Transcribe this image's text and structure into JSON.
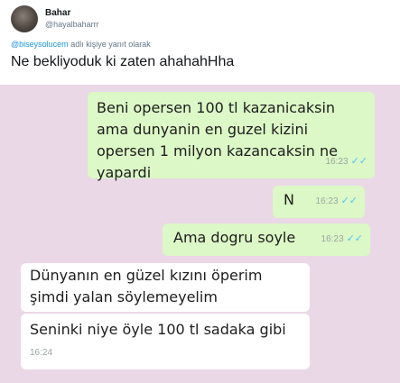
{
  "tweet": {
    "display_name": "Bahar",
    "handle": "@hayalbaharrr",
    "reply_mention": "@biseysolucem",
    "reply_suffix": "adlı kişiye yanıt olarak",
    "text": "Ne bekliyoduk ki zaten ahahahHha"
  },
  "chat": {
    "background_color": "#ead8e6",
    "messages": [
      {
        "direction": "out",
        "text": "Beni opersen 100 tl kazanicaksin ama dunyanin en guzel kizini opersen 1 milyon kazancaksin ne yapardi",
        "time": "16:23",
        "status": "read"
      },
      {
        "direction": "out",
        "text": "N",
        "time": "16:23",
        "status": "read"
      },
      {
        "direction": "out",
        "text": "Ama dogru soyle",
        "time": "16:23",
        "status": "read"
      },
      {
        "direction": "in",
        "text": "Dünyanın en güzel kızını öperim şimdi yalan söylemeyelim",
        "time": "",
        "status": ""
      },
      {
        "direction": "in",
        "text": "Seninki niye öyle 100 tl sadaka gibi",
        "time": "16:24",
        "status": ""
      }
    ]
  }
}
